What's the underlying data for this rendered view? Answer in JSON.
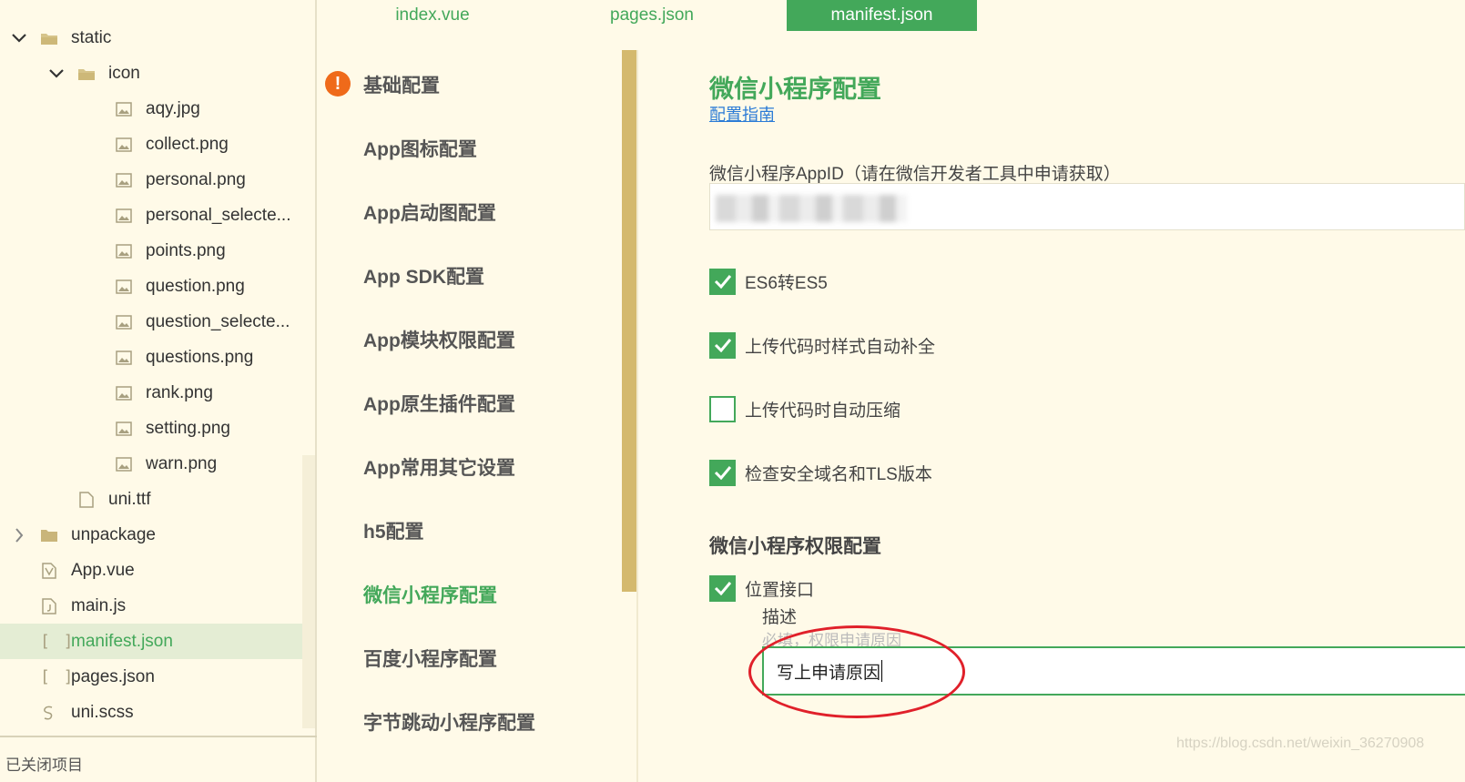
{
  "tree": {
    "items": [
      {
        "label": "static",
        "type": "folder-open",
        "indent": 0
      },
      {
        "label": "icon",
        "type": "folder-open",
        "indent": 1
      },
      {
        "label": "aqy.jpg",
        "type": "image",
        "indent": 2
      },
      {
        "label": "collect.png",
        "type": "image",
        "indent": 2
      },
      {
        "label": "personal.png",
        "type": "image",
        "indent": 2
      },
      {
        "label": "personal_selecte...",
        "type": "image",
        "indent": 2
      },
      {
        "label": "points.png",
        "type": "image",
        "indent": 2
      },
      {
        "label": "question.png",
        "type": "image",
        "indent": 2
      },
      {
        "label": "question_selecte...",
        "type": "image",
        "indent": 2
      },
      {
        "label": "questions.png",
        "type": "image",
        "indent": 2
      },
      {
        "label": "rank.png",
        "type": "image",
        "indent": 2
      },
      {
        "label": "setting.png",
        "type": "image",
        "indent": 2
      },
      {
        "label": "warn.png",
        "type": "image",
        "indent": 2
      },
      {
        "label": "uni.ttf",
        "type": "file",
        "indent": 1
      },
      {
        "label": "unpackage",
        "type": "folder-closed",
        "indent": 0
      },
      {
        "label": "App.vue",
        "type": "vue",
        "indent": 0
      },
      {
        "label": "main.js",
        "type": "js",
        "indent": 0
      },
      {
        "label": "manifest.json",
        "type": "json",
        "indent": 0,
        "selected": true
      },
      {
        "label": "pages.json",
        "type": "json",
        "indent": 0
      },
      {
        "label": "uni.scss",
        "type": "scss",
        "indent": 0
      }
    ],
    "footer": "已关闭项目"
  },
  "tabs": [
    {
      "label": "index.vue",
      "active": false
    },
    {
      "label": "pages.json",
      "active": false
    },
    {
      "label": "manifest.json",
      "active": true
    }
  ],
  "nav": {
    "items": [
      {
        "label": "基础配置",
        "warning": true
      },
      {
        "label": "App图标配置"
      },
      {
        "label": "App启动图配置"
      },
      {
        "label": "App SDK配置"
      },
      {
        "label": "App模块权限配置"
      },
      {
        "label": "App原生插件配置"
      },
      {
        "label": "App常用其它设置"
      },
      {
        "label": "h5配置"
      },
      {
        "label": "微信小程序配置",
        "active": true
      },
      {
        "label": "百度小程序配置"
      },
      {
        "label": "字节跳动小程序配置"
      }
    ],
    "warning_glyph": "!"
  },
  "main": {
    "title": "微信小程序配置",
    "guide_link": "配置指南",
    "appid_label": "微信小程序AppID（请在微信开发者工具中申请获取）",
    "options": [
      {
        "label": "ES6转ES5",
        "checked": true
      },
      {
        "label": "上传代码时样式自动补全",
        "checked": true
      },
      {
        "label": "上传代码时自动压缩",
        "checked": false
      },
      {
        "label": "检查安全域名和TLS版本",
        "checked": true
      }
    ],
    "permission_title": "微信小程序权限配置",
    "location": {
      "label": "位置接口",
      "checked": true
    },
    "description_label": "描述",
    "description_hint": "必填，权限申请原因",
    "reason_value": "写上申请原因"
  },
  "watermark": "https://blog.csdn.net/weixin_36270908",
  "colors": {
    "accent": "#43a85a",
    "background": "#fffae8",
    "annotation": "#e0202a",
    "warning": "#ef6a1a"
  }
}
